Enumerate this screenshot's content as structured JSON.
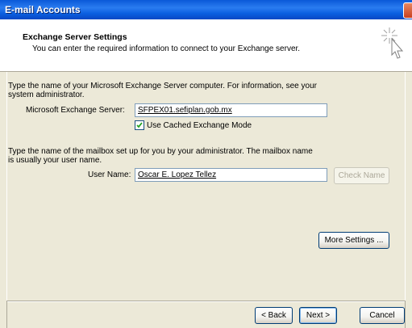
{
  "window": {
    "title": "E-mail Accounts"
  },
  "header": {
    "title": "Exchange Server Settings",
    "subtitle": "You can enter the required information to connect to your Exchange server."
  },
  "server_section": {
    "intro_line1": "Type the name of your Microsoft Exchange Server computer. For information, see your",
    "intro_line2": "system administrator.",
    "server_label": "Microsoft Exchange Server:",
    "server_value": "SFPEX01.sefiplan.gob.mx",
    "cached_label": "Use Cached Exchange Mode",
    "cached_checked": true
  },
  "mailbox_section": {
    "intro_line1": "Type the name of the mailbox set up for you by your administrator. The mailbox name",
    "intro_line2": "is usually your user name.",
    "user_label": "User Name:",
    "user_value": "Oscar E. Lopez Tellez",
    "check_name_label": "Check Name"
  },
  "buttons": {
    "more_settings": "More Settings ...",
    "back": "< Back",
    "next": "Next >",
    "cancel": "Cancel"
  },
  "colors": {
    "titlebar": "#0a59d8",
    "dialog_bg": "#ece9d8",
    "button_border": "#003c74"
  }
}
